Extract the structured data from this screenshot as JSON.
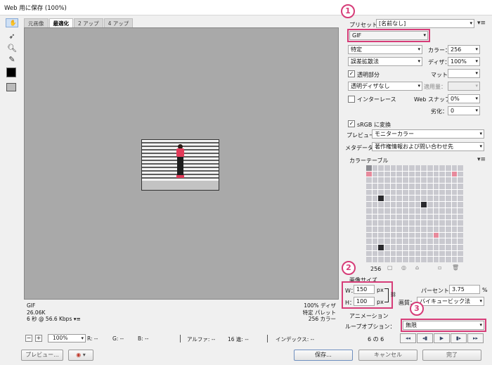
{
  "window": {
    "title": "Web 用に保存 (100%)"
  },
  "tools": [
    "hand-icon",
    "slice-select-icon",
    "zoom-icon",
    "eyedropper-icon"
  ],
  "view_tabs": [
    "元画像",
    "最適化",
    "2 アップ",
    "4 アップ"
  ],
  "info_left": [
    "GIF",
    "26.06K",
    "6 秒 @ 56.6 Kbps"
  ],
  "info_left_menu": "▾≡",
  "info_right": [
    "100% ディザ",
    "特定 パレット",
    "256 カラー"
  ],
  "status": {
    "zoom": "100%",
    "r": "R: --",
    "g": "G: --",
    "b": "B: --",
    "alpha": "アルファ: --",
    "hex": "16 進: --",
    "index": "インデックス: --"
  },
  "buttons": {
    "preview": "プレビュー...",
    "save": "保存...",
    "cancel": "キャンセル",
    "done": "完了"
  },
  "panel": {
    "preset_label": "プリセット：",
    "preset_value": "[名前なし]",
    "format": "GIF",
    "reduction": "特定",
    "colors_label": "カラー：",
    "colors_value": "256",
    "dither_algo": "誤差拡散法",
    "dither_label": "ディザ：",
    "dither_value": "100%",
    "transparency_label": "透明部分",
    "matte_label": "マット：",
    "trans_dither": "透明ディザなし",
    "amount_label": "適用量：",
    "interlace_label": "インターレース",
    "websnap_label": "Web スナップ：",
    "websnap_value": "0%",
    "lossy_label": "劣化：",
    "lossy_value": "0",
    "srgb_label": "sRGB に変換",
    "preview_label": "プレビュー：",
    "preview_value": "モニターカラー",
    "metadata_label": "メタデータ：",
    "metadata_value": "著作権情報および問い合わせ先",
    "color_table_label": "カラーテーブル",
    "color_count": "256",
    "image_size_label": "画像サイズ",
    "w_label": "W：",
    "w_value": "150",
    "h_label": "H：",
    "h_value": "100",
    "unit": "px",
    "percent_label": "パーセント：",
    "percent_value": "3.75",
    "percent_unit": "%",
    "quality_label": "画質：",
    "quality_value": "バイキュービック法",
    "animation_label": "アニメーション",
    "loop_label": "ループオプション：",
    "loop_value": "無限",
    "frame_counter": "6 の 6",
    "callouts": [
      "1",
      "2",
      "3"
    ]
  },
  "palette_colors": [
    "#c9c9cf",
    "#3a3a40",
    "#d8d8dc",
    "#e04a68",
    "#8a8a90",
    "#f2f2f4",
    "#b0b0b6",
    "#5a5a60",
    "#e78a9c",
    "#2a2a2e",
    "#9c9ca2",
    "#f8f8fa",
    "#c0485e",
    "#707076",
    "#e0e0e4",
    "#46464c"
  ]
}
